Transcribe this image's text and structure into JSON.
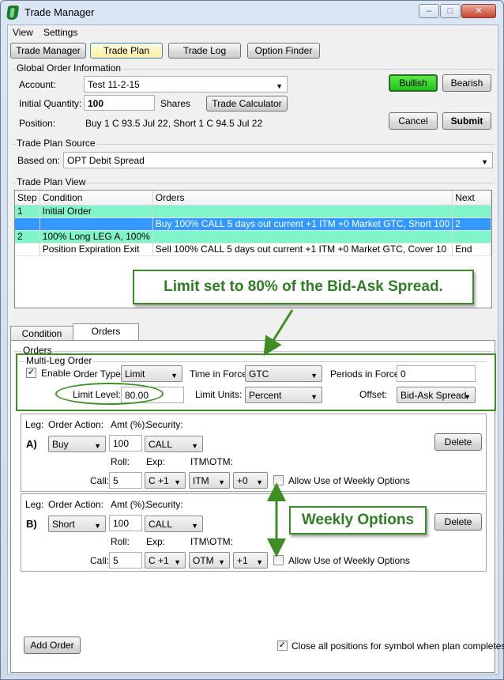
{
  "window": {
    "title": "Trade Manager"
  },
  "menu": [
    "View",
    "Settings"
  ],
  "toolbar": {
    "trade_manager": "Trade Manager",
    "trade_plan": "Trade Plan",
    "trade_log": "Trade Log",
    "option_finder": "Option Finder"
  },
  "global": {
    "title": "Global Order Information",
    "account_label": "Account:",
    "account_value": "Test 11-2-15",
    "qty_label": "Initial Quantity:",
    "qty_value": "100",
    "shares_label": "Shares",
    "calc_button": "Trade Calculator",
    "position_label": "Position:",
    "position_value": "Buy 1 C 93.5  Jul 22, Short 1 C 94.5  Jul 22",
    "bullish": "Bullish",
    "bearish": "Bearish",
    "cancel": "Cancel",
    "submit": "Submit"
  },
  "source": {
    "title": "Trade Plan Source",
    "based_on_label": "Based on:",
    "based_on_value": "OPT Debit Spread"
  },
  "plan_view": {
    "title": "Trade Plan View",
    "headers": [
      "Step",
      "Condition",
      "Orders",
      "Next"
    ],
    "rows": [
      [
        "1",
        "Initial Order",
        "",
        ""
      ],
      [
        "",
        "",
        "Buy 100% CALL 5 days out current +1 ITM +0 Market GTC, Short 100",
        "2"
      ],
      [
        "2",
        "100% Long LEG A, 100%",
        "",
        ""
      ],
      [
        "",
        "Position Expiration Exit",
        "Sell 100% CALL 5 days out current +1 ITM +0 Market GTC, Cover 10",
        "End"
      ]
    ]
  },
  "tabs": [
    "Condition",
    "Orders"
  ],
  "orders": {
    "title": "Orders",
    "multi_leg_title": "Multi-Leg Order",
    "enable_label": "Enable",
    "enable_checked": "✓",
    "order_type_label": "Order Type:",
    "order_type_value": "Limit",
    "tif_label": "Time in Force:",
    "tif_value": "GTC",
    "periods_label": "Periods in Force:",
    "periods_value": "0",
    "limit_level_label": "Limit Level:",
    "limit_level_value": "80.00",
    "limit_units_label": "Limit Units:",
    "limit_units_value": "Percent",
    "offset_label": "Offset:",
    "offset_value": "Bid-Ask Spread"
  },
  "legs": [
    {
      "id": "A)",
      "leg_label": "Leg:",
      "action_label": "Order Action:",
      "amt_label": "Amt (%):",
      "security_label": "Security:",
      "action": "Buy",
      "amt": "100",
      "security": "CALL",
      "delete": "Delete",
      "roll_label": "Roll:",
      "exp_label": "Exp:",
      "itm_label": "ITM\\OTM:",
      "call_label": "Call:",
      "roll": "5",
      "exp": "C +1",
      "itm": "ITM",
      "offset": "+0",
      "weekly_label": "Allow Use of Weekly Options"
    },
    {
      "id": "B)",
      "leg_label": "Leg:",
      "action_label": "Order Action:",
      "amt_label": "Amt (%):",
      "security_label": "Security:",
      "action": "Short",
      "amt": "100",
      "security": "CALL",
      "delete": "Delete",
      "roll_label": "Roll:",
      "exp_label": "Exp:",
      "itm_label": "ITM\\OTM:",
      "call_label": "Call:",
      "roll": "5",
      "exp": "C +1",
      "itm": "OTM",
      "offset": "+1",
      "weekly_label": "Allow Use of Weekly Options"
    }
  ],
  "footer": {
    "add_order": "Add Order",
    "close_all_checked": "✓",
    "close_all_label": "Close all positions for symbol when plan completes."
  },
  "annotations": {
    "limit_callout": "Limit set to 80% of the Bid-Ask Spread.",
    "weekly_callout": "Weekly Options"
  },
  "colors": {
    "accent_green": "#3e8e24",
    "bullish": "#1ec41a",
    "row_aqua": "#7ff5c9",
    "row_selected": "#3399ff"
  }
}
